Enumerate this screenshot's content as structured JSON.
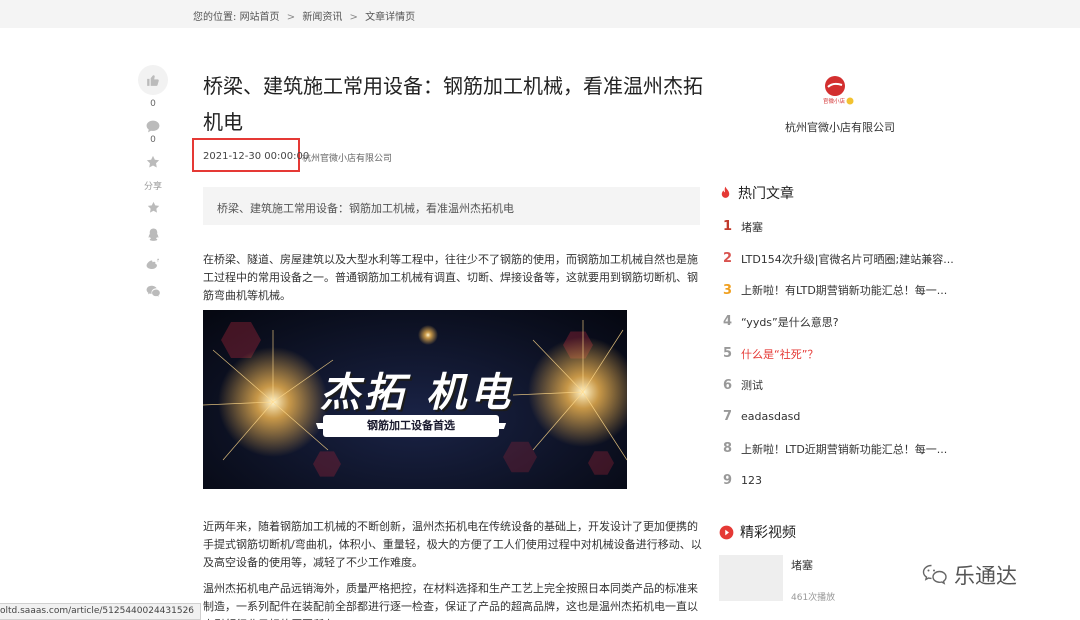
{
  "breadcrumb": {
    "prefix": "您的位置:",
    "items": [
      "网站首页",
      "新闻资讯",
      "文章详情页"
    ],
    "separator": ">"
  },
  "share_rail": {
    "like_count": "0",
    "comment_count": "0",
    "share_label": "分享"
  },
  "article": {
    "title": "桥梁、建筑施工常用设备：钢筋加工机械，看准温州杰拓机电",
    "date": "2021-12-30 00:00:00",
    "author": "杭州官微小店有限公司",
    "summary": "桥梁、建筑施工常用设备：钢筋加工机械，看准温州杰拓机电",
    "paragraph1": "在桥梁、隧道、房屋建筑以及大型水利等工程中，往往少不了钢筋的使用，而钢筋加工机械自然也是施工过程中的常用设备之一。普通钢筋加工机械有调直、切断、焊接设备等，这就要用到钢筋切断机、钢筋弯曲机等机械。",
    "banner_brand": "杰拓 机电",
    "banner_tagline": "钢筋加工设备首选",
    "paragraph2": "近两年来，随着钢筋加工机械的不断创新，温州杰拓机电在传统设备的基础上，开发设计了更加便携的手提式钢筋切断机/弯曲机，体积小、重量轻，极大的方便了工人们使用过程中对机械设备进行移动、以及高空设备的使用等，减轻了不少工作难度。",
    "paragraph3": "温州杰拓机电产品远销海外，质量严格把控，在材料选择和生产工艺上完全按照日本同类产品的标准来制造，一系列配件在装配前全部都进行逐一检查，保证了产品的超高品牌，这也是温州杰拓机电一直以来引领行业目标的原因所在。"
  },
  "company": {
    "logo_text": "官微小店",
    "name": "杭州官微小店有限公司"
  },
  "hot_articles": {
    "title": "热门文章",
    "items": [
      {
        "rank": "1",
        "text": "堵塞"
      },
      {
        "rank": "2",
        "text": "LTD154次升级|官微名片可晒圈;建站兼容..."
      },
      {
        "rank": "3",
        "text": "上新啦！有LTD期营销新功能汇总！每一..."
      },
      {
        "rank": "4",
        "text": "“yyds”是什么意思?"
      },
      {
        "rank": "5",
        "text": "什么是“社死”？"
      },
      {
        "rank": "6",
        "text": "测试"
      },
      {
        "rank": "7",
        "text": "eadasdasd"
      },
      {
        "rank": "8",
        "text": "上新啦！LTD近期营销新功能汇总！每一..."
      },
      {
        "rank": "9",
        "text": "123"
      }
    ]
  },
  "videos": {
    "title": "精彩视频",
    "items": [
      {
        "title": "堵塞",
        "views": "461次播放"
      }
    ]
  },
  "watermark": "乐通达",
  "status_url": "oltd.saaas.com/article/5125440024431526",
  "colors": {
    "accent_red": "#e53935",
    "rank1": "#c0392b",
    "rank3": "#f0a020"
  }
}
